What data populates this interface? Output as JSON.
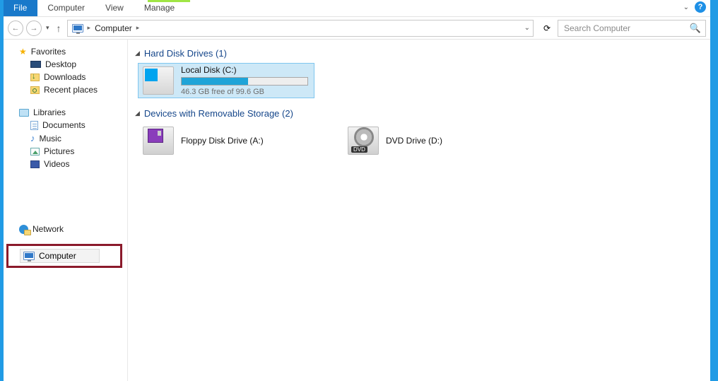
{
  "ribbon": {
    "file": "File",
    "tabs": [
      "Computer",
      "View"
    ],
    "tools_tab": "Manage"
  },
  "nav": {
    "breadcrumb_root": "Computer",
    "search_placeholder": "Search Computer"
  },
  "sidebar": {
    "favorites": {
      "label": "Favorites",
      "items": [
        {
          "label": "Desktop",
          "icon": "desktop"
        },
        {
          "label": "Downloads",
          "icon": "downloads"
        },
        {
          "label": "Recent places",
          "icon": "recent"
        }
      ]
    },
    "libraries": {
      "label": "Libraries",
      "items": [
        {
          "label": "Documents",
          "icon": "documents"
        },
        {
          "label": "Music",
          "icon": "music"
        },
        {
          "label": "Pictures",
          "icon": "pictures"
        },
        {
          "label": "Videos",
          "icon": "videos"
        }
      ]
    },
    "computer": {
      "label": "Computer"
    },
    "network": {
      "label": "Network"
    }
  },
  "main": {
    "section_drives": {
      "title": "Hard Disk Drives (1)",
      "items": [
        {
          "name": "Local Disk (C:)",
          "free_text": "46.3 GB free of 99.6 GB",
          "used_pct": 53
        }
      ]
    },
    "section_removable": {
      "title": "Devices with Removable Storage (2)",
      "items": [
        {
          "name": "Floppy Disk Drive (A:)",
          "kind": "floppy"
        },
        {
          "name": "DVD Drive (D:)",
          "kind": "dvd"
        }
      ]
    }
  }
}
